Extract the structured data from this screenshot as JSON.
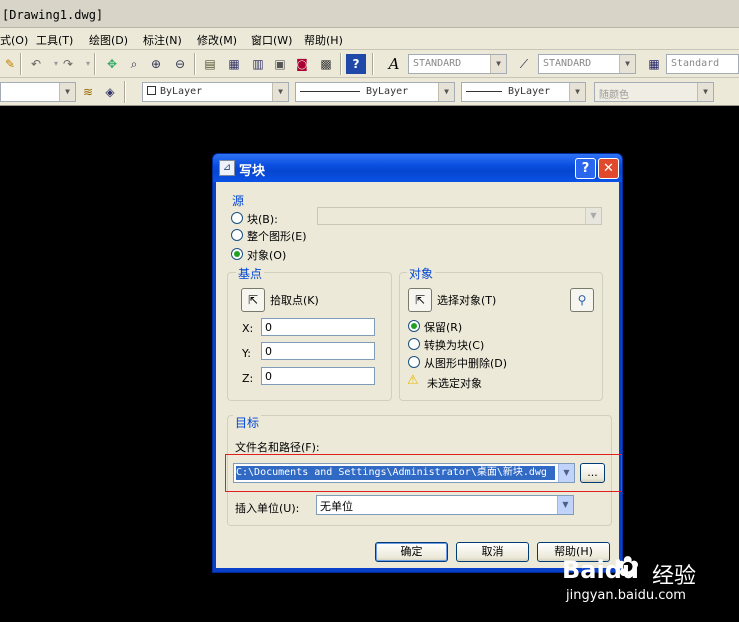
{
  "window": {
    "title": "[Drawing1.dwg]"
  },
  "menubar": {
    "items": [
      "式(O)",
      "工具(T)",
      "绘图(D)",
      "标注(N)",
      "修改(M)",
      "窗口(W)",
      "帮助(H)"
    ]
  },
  "toolbar1": {
    "text_style": "STANDARD",
    "dim_style": "STANDARD",
    "table_style": "Standard"
  },
  "toolbar2": {
    "color": "ByLayer",
    "linetype": "ByLayer",
    "lineweight": "ByLayer",
    "plotstyle": "随颜色"
  },
  "dialog": {
    "title": "写块",
    "help_glyph": "?",
    "close_glyph": "✕",
    "source": {
      "label": "源",
      "options": [
        {
          "label": "块(B):",
          "selected": false
        },
        {
          "label": "整个图形(E)",
          "selected": false
        },
        {
          "label": "对象(O)",
          "selected": true
        }
      ],
      "block_value": ""
    },
    "basepoint": {
      "label": "基点",
      "pick_label": "拾取点(K)",
      "x_label": "X:",
      "y_label": "Y:",
      "z_label": "Z:",
      "x": "0",
      "y": "0",
      "z": "0"
    },
    "objects": {
      "label": "对象",
      "select_label": "选择对象(T)",
      "options": [
        {
          "label": "保留(R)",
          "selected": true
        },
        {
          "label": "转换为块(C)",
          "selected": false
        },
        {
          "label": "从图形中删除(D)",
          "selected": false
        }
      ],
      "status": "未选定对象"
    },
    "destination": {
      "label": "目标",
      "path_label": "文件名和路径(F):",
      "path_value": "C:\\Documents and Settings\\Administrator\\桌面\\新块.dwg",
      "browse_label": "...",
      "units_label": "插入单位(U):",
      "units_value": "无单位"
    },
    "buttons": {
      "ok": "确定",
      "cancel": "取消",
      "help": "帮助(H)"
    }
  },
  "watermark": {
    "brand": "Baidu",
    "product": "经验",
    "url": "jingyan.baidu.com"
  },
  "colors": {
    "title_blue": "#0a4fe0",
    "group_label": "#0046d5",
    "selection": "#316ac5",
    "highlight_box": "#e02020"
  }
}
